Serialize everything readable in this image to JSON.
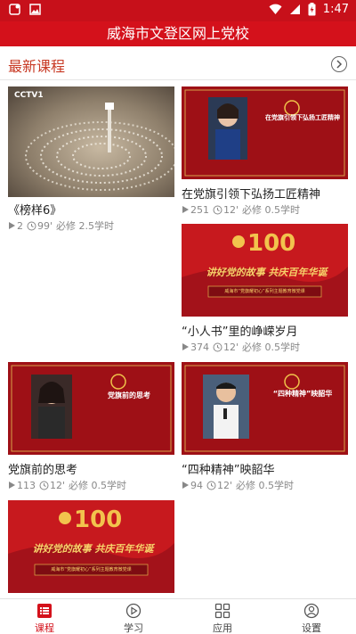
{
  "status_bar": {
    "time": "1:47"
  },
  "app": {
    "title": "威海市文登区网上党校"
  },
  "section": {
    "title": "最新课程"
  },
  "courses": [
    {
      "title": "《榜样6》",
      "views": "2",
      "duration": "99'",
      "credit": "必修 2.5学时",
      "thumb_caption": "CCTV1"
    },
    {
      "title": "在党旗引领下弘扬工匠精神",
      "views": "251",
      "duration": "12'",
      "credit": "必修 0.5学时",
      "thumb_caption": "在党旗引领下弘扬工匠精神"
    },
    {
      "title": "“小人书”里的峥嵘岁月",
      "views": "374",
      "duration": "12'",
      "credit": "必修 0.5学时",
      "thumb_caption": "讲好党的故事 共庆百年华诞"
    },
    {
      "title": "党旗前的思考",
      "views": "113",
      "duration": "12'",
      "credit": "必修 0.5学时",
      "thumb_caption": "党旗前的思考"
    },
    {
      "title": "“四种精神”映韶华",
      "views": "94",
      "duration": "12'",
      "credit": "必修 0.5学时",
      "thumb_caption": "“四种精神”映韶华"
    },
    {
      "thumb_caption": "讲好党的故事 共庆百年华诞"
    }
  ],
  "thumb_banner": {
    "line": "威海市“党旗耀初心”系列主题教育微党课"
  },
  "tabs": [
    {
      "label": "课程",
      "icon": "list-icon",
      "active": true
    },
    {
      "label": "学习",
      "icon": "play-circle-icon",
      "active": false
    },
    {
      "label": "应用",
      "icon": "grid-icon",
      "active": false
    },
    {
      "label": "设置",
      "icon": "user-circle-icon",
      "active": false
    }
  ],
  "colors": {
    "brand_red": "#d4111b",
    "section_title": "#c83a25",
    "meta_gray": "#888888"
  }
}
